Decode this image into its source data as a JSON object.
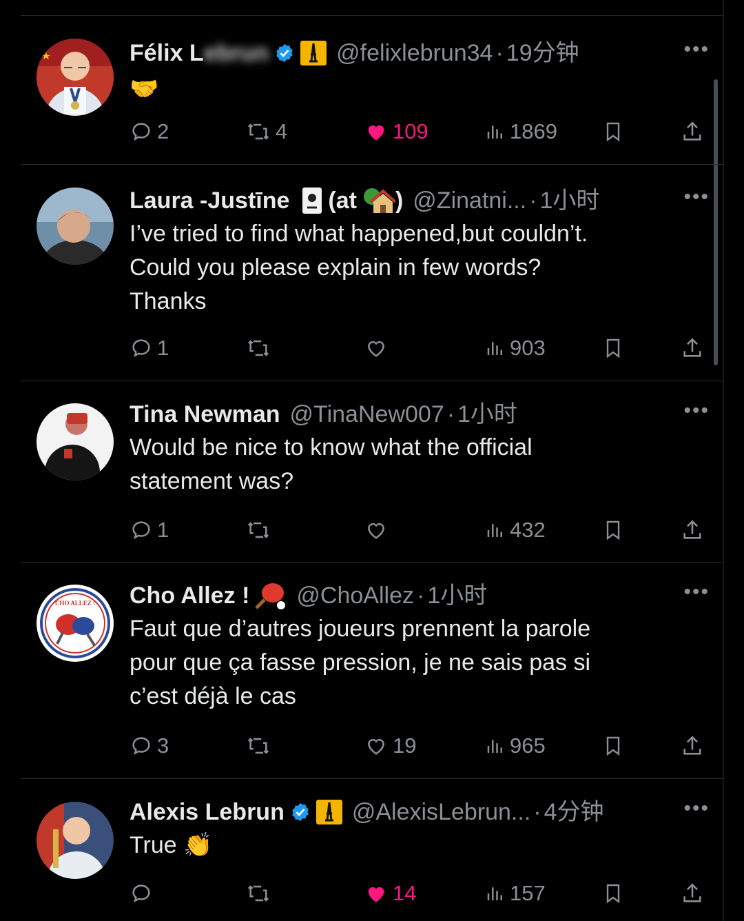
{
  "tweets": [
    {
      "name": "Félix Lebrun",
      "handle": "@felixlebrun34",
      "sep": "·",
      "time": "19分钟",
      "text": "",
      "emoji": "🤝",
      "actions": {
        "replies": "2",
        "reposts": "4",
        "likes": "109",
        "views": "1869"
      },
      "liked": true
    },
    {
      "name": "Laura -Justīne",
      "name_suffix": "(at",
      "name_suffix_end": ")",
      "handle": "@Zinatni...",
      "sep": "·",
      "time": "1小时",
      "text_lines": [
        "I’ve tried to find what happened,but couldn’t.",
        "Could you please explain in few words?",
        "Thanks"
      ],
      "actions": {
        "replies": "1",
        "reposts": "",
        "likes": "",
        "views": "903"
      },
      "liked": false
    },
    {
      "name": "Tina Newman",
      "handle": "@TinaNew007",
      "sep": "·",
      "time": "1小时",
      "text_lines": [
        "Would be nice to know what the official",
        "statement was?"
      ],
      "actions": {
        "replies": "1",
        "reposts": "",
        "likes": "",
        "views": "432"
      },
      "liked": false
    },
    {
      "name": "Cho Allez !",
      "handle": "@ChoAllez",
      "sep": "·",
      "time": "1小时",
      "text_lines": [
        "Faut que d’autres joueurs prennent la parole",
        "pour que ça fasse pression, je ne sais pas si",
        "c’est déjà le cas"
      ],
      "avatar_text": "CHO ALLEZ !",
      "actions": {
        "replies": "3",
        "reposts": "",
        "likes": "19",
        "views": "965"
      },
      "liked": false
    },
    {
      "name": "Alexis Lebrun",
      "handle": "@AlexisLebrun...",
      "sep": "·",
      "time": "4分钟",
      "text_lines": [
        "True"
      ],
      "emoji": "👏",
      "actions": {
        "replies": "",
        "reposts": "",
        "likes": "14",
        "views": "157"
      },
      "liked": true
    }
  ],
  "more_label": "•••",
  "icons": {
    "reply": "reply-icon",
    "repost": "repost-icon",
    "like": "heart-icon",
    "views": "views-icon",
    "bookmark": "bookmark-icon",
    "share": "share-icon",
    "verified": "verified-badge-icon",
    "affiliate": "eiffel-tower-badge-icon"
  },
  "colors": {
    "background": "#000000",
    "text": "#e7e9ea",
    "muted": "#8b9096",
    "like": "#f91880",
    "verified": "#1d9bf0",
    "badge": "#f5b400"
  }
}
